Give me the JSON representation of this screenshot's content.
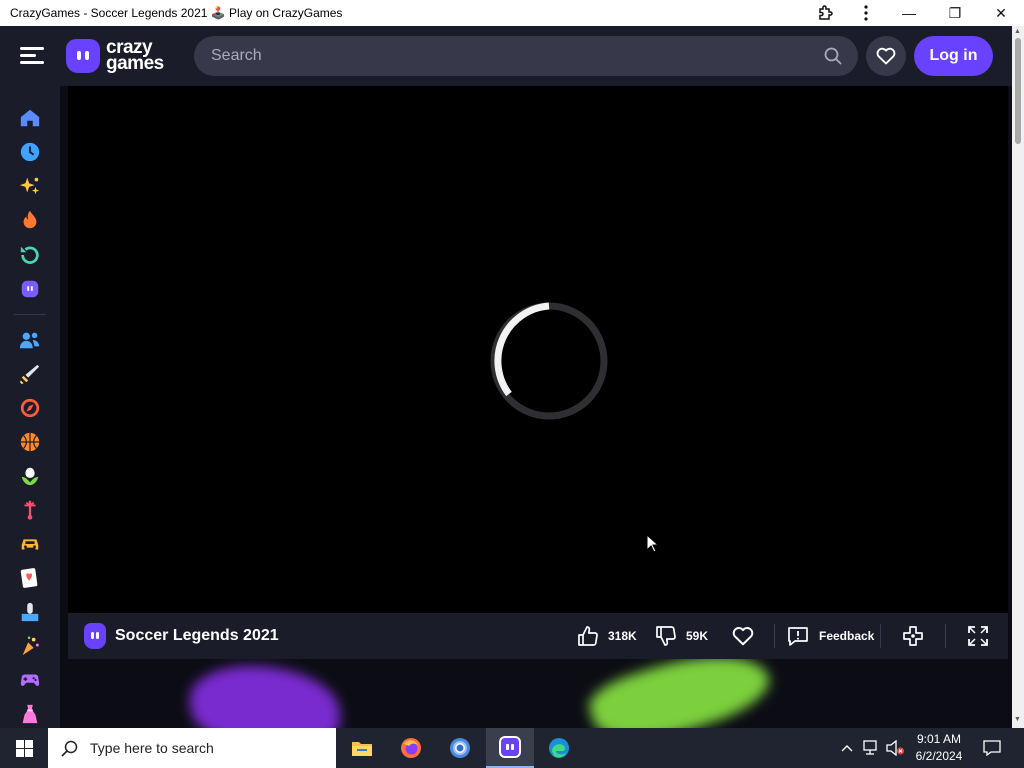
{
  "window": {
    "title": "CrazyGames - Soccer Legends 2021 🕹️ Play on CrazyGames",
    "extensions_icon": "puzzle-icon",
    "menu_icon": "more-vertical-icon",
    "controls": {
      "minimize": "—",
      "restore": "❐",
      "close": "✕"
    }
  },
  "header": {
    "logo_line1": "crazy",
    "logo_line2": "games",
    "search_placeholder": "Search",
    "login_label": "Log in"
  },
  "sidebar": {
    "items": [
      {
        "name": "home-icon",
        "color": "#5b8cff"
      },
      {
        "name": "recent-icon",
        "color": "#3fa2ff"
      },
      {
        "name": "new-icon",
        "color": "#ffc93c"
      },
      {
        "name": "trending-icon",
        "color": "#ff7a2f"
      },
      {
        "name": "updated-icon",
        "color": "#48d6a8"
      },
      {
        "name": "originals-icon",
        "color": "#7a5cff"
      },
      {
        "name": "multiplayer-icon",
        "color": "#4aa8ff"
      },
      {
        "name": "action-icon",
        "color": "#ffcf5c"
      },
      {
        "name": "adventure-icon",
        "color": "#ff5a3c"
      },
      {
        "name": "basketball-icon",
        "color": "#ff8a2a"
      },
      {
        "name": "beauty-icon",
        "color": "#7bd84a"
      },
      {
        "name": "bike-icon",
        "color": "#ff4d6d"
      },
      {
        "name": "car-icon",
        "color": "#ffb62e"
      },
      {
        "name": "card-icon",
        "color": "#ff5b5b"
      },
      {
        "name": "clicker-icon",
        "color": "#4aa8ff"
      },
      {
        "name": "casual-icon",
        "color": "#ffa53c"
      },
      {
        "name": "controller-icon",
        "color": "#b46cff"
      },
      {
        "name": "dress-up-icon",
        "color": "#ff7ad9"
      }
    ]
  },
  "game": {
    "title": "Soccer Legends 2021",
    "likes": "318K",
    "dislikes": "59K",
    "feedback_label": "Feedback",
    "loading": true
  },
  "taskbar": {
    "search_placeholder": "Type here to search",
    "time": "9:01 AM",
    "date": "6/2/2024",
    "apps": [
      "file-explorer-icon",
      "firefox-icon",
      "chrome-icon",
      "crazygames-icon",
      "edge-icon"
    ]
  }
}
